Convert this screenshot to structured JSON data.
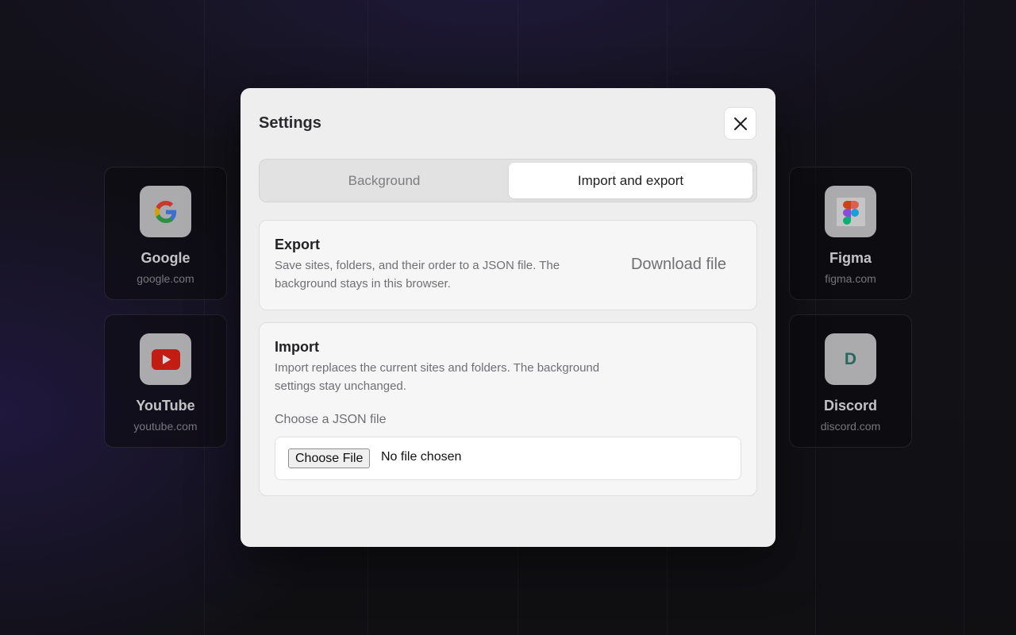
{
  "background_sites": [
    {
      "name": "Google",
      "url": "google.com",
      "icon": "google-icon"
    },
    {
      "name": "YouTube",
      "url": "youtube.com",
      "icon": "youtube-icon"
    },
    {
      "name": "Figma",
      "url": "figma.com",
      "icon": "figma-icon"
    },
    {
      "name": "Discord",
      "url": "discord.com",
      "icon": "D",
      "icon_color": "#2f7a6b"
    }
  ],
  "modal": {
    "title": "Settings",
    "close_icon": "close-icon",
    "tabs": [
      {
        "label": "Background",
        "active": false
      },
      {
        "label": "Import and export",
        "active": true
      }
    ],
    "export": {
      "title": "Export",
      "description": "Save sites, folders, and their order to a JSON file. The background stays in this browser.",
      "button_label": "Download file"
    },
    "import": {
      "title": "Import",
      "description": "Import replaces the current sites and folders. The background settings stay unchanged.",
      "file_label": "Choose a JSON file",
      "choose_button": "Choose File",
      "file_status": "No file chosen"
    }
  },
  "colors": {
    "modal_bg": "#eeeeee",
    "page_bg": "#141418",
    "youtube_red": "#e62117"
  }
}
